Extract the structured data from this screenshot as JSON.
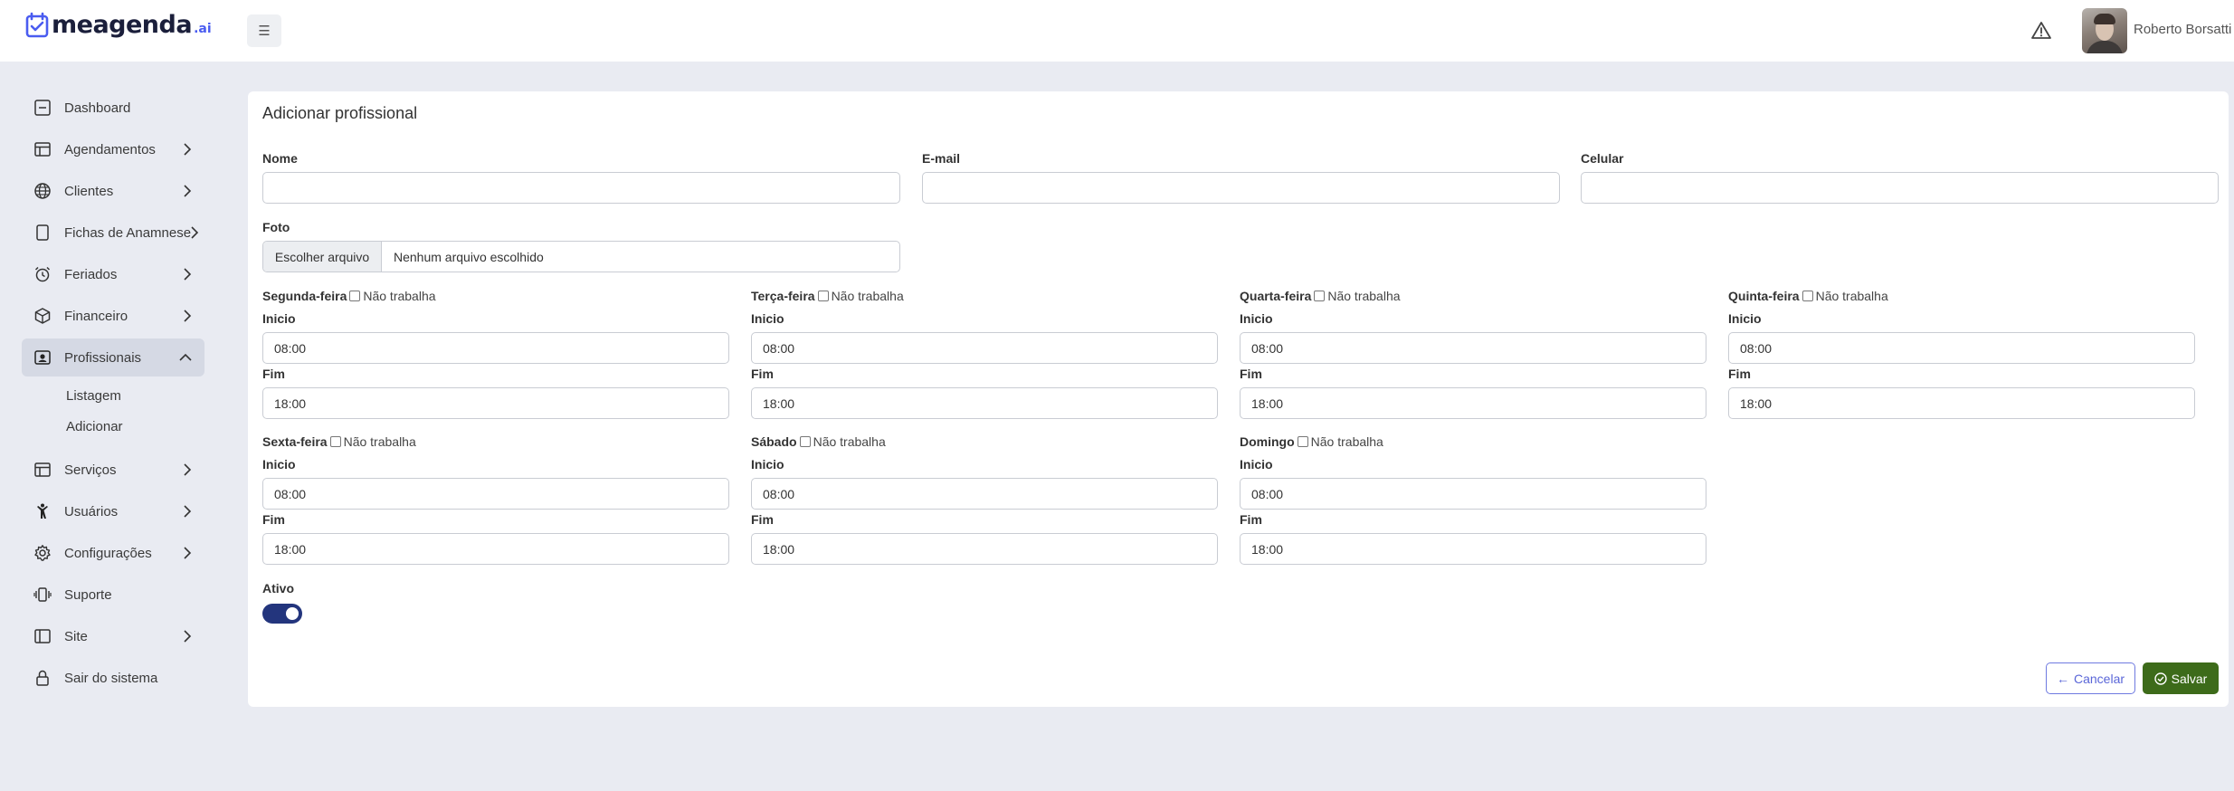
{
  "app": {
    "logo_main": "meagenda",
    "logo_suffix": ".ai"
  },
  "header": {
    "menu_icon": "☰",
    "user_name": "Roberto Borsatti"
  },
  "sidebar": {
    "items": [
      {
        "label": "Dashboard",
        "icon": "dashboard-icon"
      },
      {
        "label": "Agendamentos",
        "icon": "calendar-table-icon"
      },
      {
        "label": "Clientes",
        "icon": "globe-icon"
      },
      {
        "label": "Fichas de Anamnese",
        "icon": "tablet-icon"
      },
      {
        "label": "Feriados",
        "icon": "alarm-clock-icon"
      },
      {
        "label": "Financeiro",
        "icon": "box-icon"
      },
      {
        "label": "Profissionais",
        "icon": "person-badge-icon"
      },
      {
        "label": "Serviços",
        "icon": "table-icon"
      },
      {
        "label": "Usuários",
        "icon": "person-icon"
      },
      {
        "label": "Configurações",
        "icon": "gear-icon"
      },
      {
        "label": "Suporte",
        "icon": "phone-vibrate-icon"
      },
      {
        "label": "Site",
        "icon": "layout-icon"
      },
      {
        "label": "Sair do sistema",
        "icon": "lock-icon"
      }
    ],
    "sub_items": [
      {
        "label": "Listagem"
      },
      {
        "label": "Adicionar"
      }
    ]
  },
  "form": {
    "title": "Adicionar profissional",
    "nome_label": "Nome",
    "nome_value": "",
    "email_label": "E-mail",
    "email_value": "",
    "celular_label": "Celular",
    "celular_value": "",
    "foto_label": "Foto",
    "file_button": "Escolher arquivo",
    "file_status": "Nenhum arquivo escolhido",
    "not_work_label": "Não trabalha",
    "start_label": "Inicio",
    "end_label": "Fim",
    "days": [
      {
        "name": "Segunda-feira",
        "start": "08:00",
        "end": "18:00",
        "not_working": false
      },
      {
        "name": "Terça-feira",
        "start": "08:00",
        "end": "18:00",
        "not_working": false
      },
      {
        "name": "Quarta-feira",
        "start": "08:00",
        "end": "18:00",
        "not_working": false
      },
      {
        "name": "Quinta-feira",
        "start": "08:00",
        "end": "18:00",
        "not_working": false
      },
      {
        "name": "Sexta-feira",
        "start": "08:00",
        "end": "18:00",
        "not_working": false
      },
      {
        "name": "Sábado",
        "start": "08:00",
        "end": "18:00",
        "not_working": false
      },
      {
        "name": "Domingo",
        "start": "08:00",
        "end": "18:00",
        "not_working": false
      }
    ],
    "active_label": "Ativo",
    "active": true,
    "cancel_label": "Cancelar",
    "save_label": "Salvar"
  },
  "colors": {
    "accent": "#23357d",
    "save": "#3d6b1a",
    "cancel": "#5a66d8",
    "background": "#e9ebf2"
  }
}
